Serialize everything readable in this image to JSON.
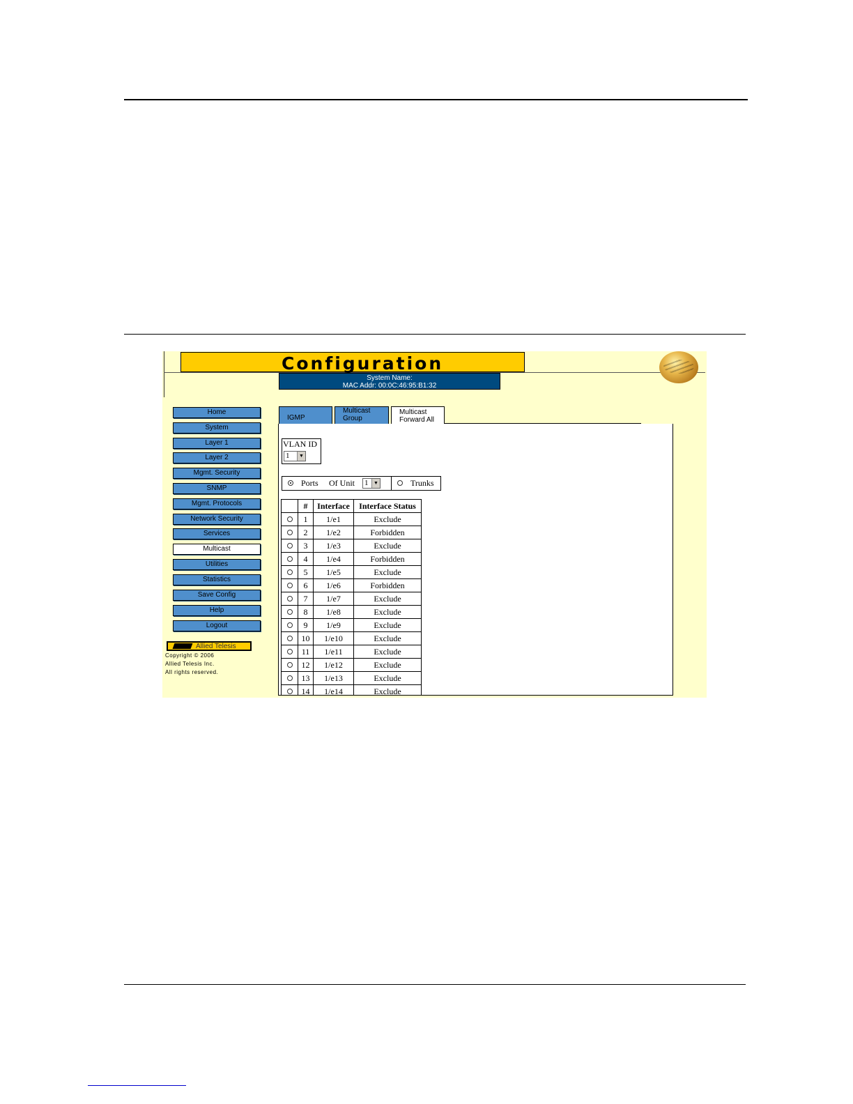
{
  "header": {
    "title": "Configuration",
    "system_name": "System Name:",
    "mac_addr": "MAC Addr: 00:0C:46:95:B1:32"
  },
  "nav": [
    "Home",
    "System",
    "Layer 1",
    "Layer 2",
    "Mgmt. Security",
    "SNMP",
    "Mgmt. Protocols",
    "Network Security",
    "Services",
    "Multicast",
    "Utilities",
    "Statistics",
    "Save Config",
    "Help",
    "Logout"
  ],
  "nav_active": "Multicast",
  "logo": {
    "text": "Allied Telesis"
  },
  "copyright": [
    "Copyright © 2006",
    "Allied Telesis  Inc.",
    "All rights reserved."
  ],
  "tabs": {
    "igmp": "IGMP",
    "multicast_group_1": "Multicast",
    "multicast_group_2": "Group",
    "forward_all_1": "Multicast",
    "forward_all_2": "Forward All"
  },
  "vlan": {
    "label": "VLAN ID",
    "value": "1"
  },
  "ports": {
    "ports_label": "Ports",
    "of_unit_label": "Of Unit",
    "unit_value": "1",
    "trunks_label": "Trunks",
    "selected": "Ports"
  },
  "table": {
    "headers": [
      "",
      "#",
      "Interface",
      "Interface Status"
    ],
    "rows": [
      {
        "num": "1",
        "iface": "1/e1",
        "status": "Exclude"
      },
      {
        "num": "2",
        "iface": "1/e2",
        "status": "Forbidden"
      },
      {
        "num": "3",
        "iface": "1/e3",
        "status": "Exclude"
      },
      {
        "num": "4",
        "iface": "1/e4",
        "status": "Forbidden"
      },
      {
        "num": "5",
        "iface": "1/e5",
        "status": "Exclude"
      },
      {
        "num": "6",
        "iface": "1/e6",
        "status": "Forbidden"
      },
      {
        "num": "7",
        "iface": "1/e7",
        "status": "Exclude"
      },
      {
        "num": "8",
        "iface": "1/e8",
        "status": "Exclude"
      },
      {
        "num": "9",
        "iface": "1/e9",
        "status": "Exclude"
      },
      {
        "num": "10",
        "iface": "1/e10",
        "status": "Exclude"
      },
      {
        "num": "11",
        "iface": "1/e11",
        "status": "Exclude"
      },
      {
        "num": "12",
        "iface": "1/e12",
        "status": "Exclude"
      },
      {
        "num": "13",
        "iface": "1/e13",
        "status": "Exclude"
      },
      {
        "num": "14",
        "iface": "1/e14",
        "status": "Exclude"
      }
    ]
  },
  "colors": {
    "title_bg": "#ffcc00",
    "page_bg": "#ffffcc",
    "nav_bg": "#4f8fcc",
    "sysbox_bg": "#004a7f"
  }
}
